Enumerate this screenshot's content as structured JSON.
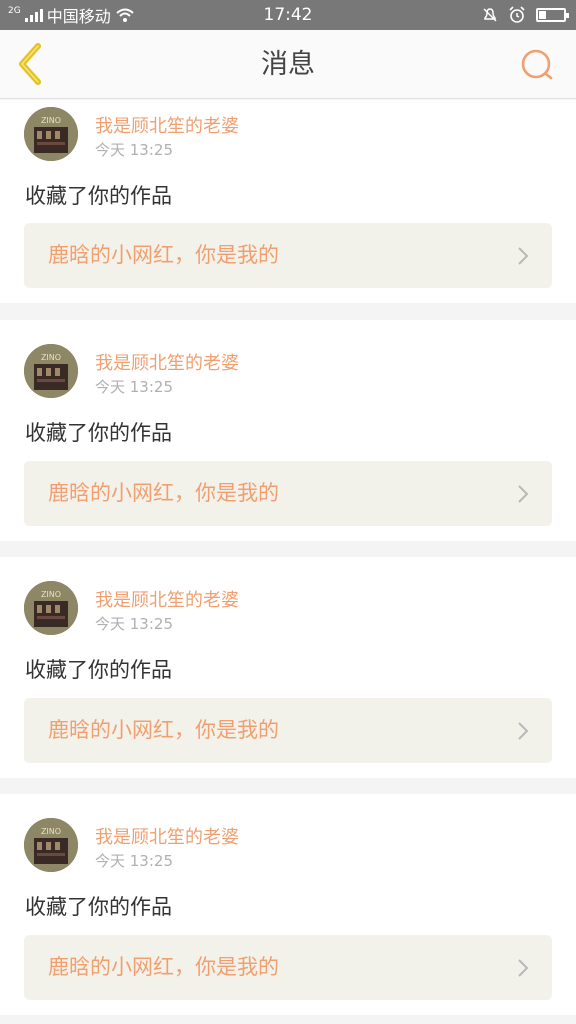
{
  "status_bar": {
    "network_type": "2G",
    "carrier": "中国移动",
    "time": "17:42"
  },
  "nav": {
    "title": "消息"
  },
  "colors": {
    "accent": "#f0a070",
    "back_arrow": "#e6c21e",
    "work_box_bg": "#f3f2ea"
  },
  "messages": [
    {
      "username": "我是顾北笙的老婆",
      "time": "今天 13:25",
      "action": "收藏了你的作品",
      "work_title": "鹿晗的小网红，你是我的"
    },
    {
      "username": "我是顾北笙的老婆",
      "time": "今天 13:25",
      "action": "收藏了你的作品",
      "work_title": "鹿晗的小网红，你是我的"
    },
    {
      "username": "我是顾北笙的老婆",
      "time": "今天 13:25",
      "action": "收藏了你的作品",
      "work_title": "鹿晗的小网红，你是我的"
    },
    {
      "username": "我是顾北笙的老婆",
      "time": "今天 13:25",
      "action": "收藏了你的作品",
      "work_title": "鹿晗的小网红，你是我的"
    }
  ]
}
